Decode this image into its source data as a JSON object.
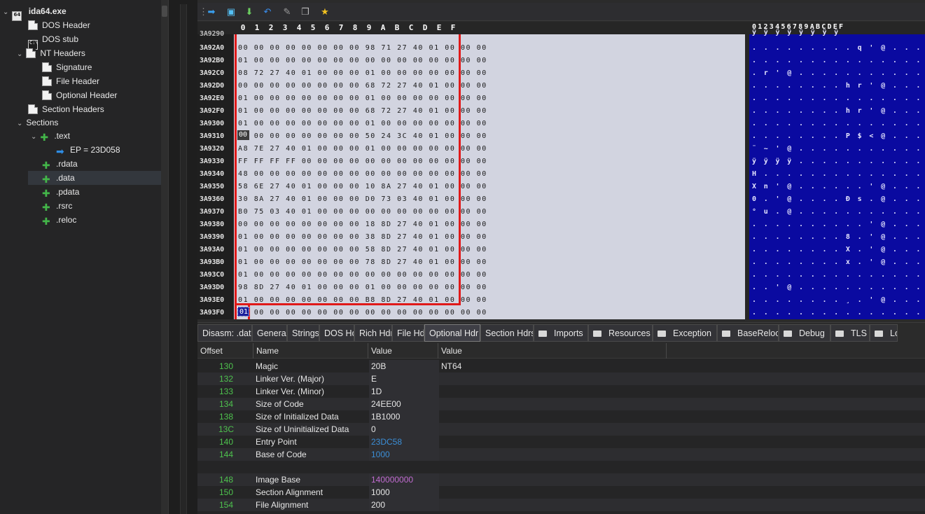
{
  "tree": {
    "root": "ida64.exe",
    "items": [
      {
        "label": "DOS Header",
        "icon": "document-icon"
      },
      {
        "label": "DOS stub",
        "icon": "console-icon"
      },
      {
        "label": "NT Headers",
        "icon": "document-icon"
      },
      {
        "label": "Signature",
        "icon": "document-icon"
      },
      {
        "label": "File Header",
        "icon": "document-icon"
      },
      {
        "label": "Optional Header",
        "icon": "document-icon"
      },
      {
        "label": "Section Headers",
        "icon": "document-icon"
      },
      {
        "label": "Sections",
        "icon": ""
      },
      {
        "label": ".text",
        "icon": "puzzle-icon"
      },
      {
        "label": "EP = 23D058",
        "icon": "arrow-right-icon"
      },
      {
        "label": ".rdata",
        "icon": "puzzle-icon"
      },
      {
        "label": ".data",
        "icon": "puzzle-icon"
      },
      {
        "label": ".pdata",
        "icon": "puzzle-icon"
      },
      {
        "label": ".rsrc",
        "icon": "puzzle-icon"
      },
      {
        "label": ".reloc",
        "icon": "puzzle-icon"
      }
    ]
  },
  "hex": {
    "columns": [
      "0",
      "1",
      "2",
      "3",
      "4",
      "5",
      "6",
      "7",
      "8",
      "9",
      "A",
      "B",
      "C",
      "D",
      "E",
      "F"
    ],
    "ascii_columns": "0123456789ABCDEF",
    "top_partial_addr": "3A9290",
    "rows": [
      {
        "addr": "3A92A0",
        "bytes": "00 00 00 00 00 00 00 00 98 71 27 40 01 00 00 00",
        "ascii": ". . . . . . . . . q ' @ . . . ."
      },
      {
        "addr": "3A92B0",
        "bytes": "01 00 00 00 00 00 00 00 00 00 00 00 00 00 00 00",
        "ascii": ". . . . . . . . . . . . . . . ."
      },
      {
        "addr": "3A92C0",
        "bytes": "08 72 27 40 01 00 00 00 01 00 00 00 00 00 00 00",
        "ascii": ". r ' @ . . . . . . . . . . . ."
      },
      {
        "addr": "3A92D0",
        "bytes": "00 00 00 00 00 00 00 00 68 72 27 40 01 00 00 00",
        "ascii": ". . . . . . . . h r ' @ . . . ."
      },
      {
        "addr": "3A92E0",
        "bytes": "01 00 00 00 00 00 00 00 01 00 00 00 00 00 00 00",
        "ascii": ". . . . . . . . . . . . . . . ."
      },
      {
        "addr": "3A92F0",
        "bytes": "01 00 00 00 00 00 00 00 68 72 27 40 01 00 00 00",
        "ascii": ". . . . . . . . h r ' @ . . . ."
      },
      {
        "addr": "3A9300",
        "bytes": "01 00 00 00 00 00 00 00 01 00 00 00 00 00 00 00",
        "ascii": ". . . . . . . . . . . . . . . ."
      },
      {
        "addr": "3A9310",
        "bytes": "00 00 00 00 00 00 00 00 50 24 3C 40 01 00 00 00",
        "ascii": ". . . . . . . . P $ < @ . . . ."
      },
      {
        "addr": "3A9320",
        "bytes": "A8 7E 27 40 01 00 00 00 01 00 00 00 00 00 00 00",
        "ascii": "¨ ~ ' @ . . . . . . . . . . . ."
      },
      {
        "addr": "3A9330",
        "bytes": "FF FF FF FF 00 00 00 00 00 00 00 00 00 00 00 00",
        "ascii": "ÿ ÿ ÿ ÿ . . . . . . . . . . . ."
      },
      {
        "addr": "3A9340",
        "bytes": "48 00 00 00 00 00 00 00 00 00 00 00 00 00 00 00",
        "ascii": "H . . . . . . . . . . . . . . ."
      },
      {
        "addr": "3A9350",
        "bytes": "58 6E 27 40 01 00 00 00 10 8A 27 40 01 00 00 00",
        "ascii": "X n ' @ . . . . . . ' @ . . . ."
      },
      {
        "addr": "3A9360",
        "bytes": "30 8A 27 40 01 00 00 00 D0 73 03 40 01 00 00 00",
        "ascii": "0 . ' @ . . . . Ð s . @ . . . ."
      },
      {
        "addr": "3A9370",
        "bytes": "B0 75 03 40 01 00 00 00 00 00 00 00 00 00 00 00",
        "ascii": "° u . @ . . . . . . . . . . . ."
      },
      {
        "addr": "3A9380",
        "bytes": "00 00 00 00 00 00 00 00 18 8D 27 40 01 00 00 00",
        "ascii": ". . . . . . . . . . ' @ . . . ."
      },
      {
        "addr": "3A9390",
        "bytes": "01 00 00 00 00 00 00 00 38 8D 27 40 01 00 00 00",
        "ascii": ". . . . . . . . 8 . ' @ . . . ."
      },
      {
        "addr": "3A93A0",
        "bytes": "01 00 00 00 00 00 00 00 58 8D 27 40 01 00 00 00",
        "ascii": ". . . . . . . . X . ' @ . . . ."
      },
      {
        "addr": "3A93B0",
        "bytes": "01 00 00 00 00 00 00 00 78 8D 27 40 01 00 00 00",
        "ascii": ". . . . . . . . x . ' @ . . . ."
      },
      {
        "addr": "3A93C0",
        "bytes": "01 00 00 00 00 00 00 00 00 00 00 00 00 00 00 00",
        "ascii": ". . . . . . . . . . . . . . . ."
      },
      {
        "addr": "3A93D0",
        "bytes": "98 8D 27 40 01 00 00 00 01 00 00 00 00 00 00 00",
        "ascii": ". . ' @ . . . . . . . . . . . ."
      },
      {
        "addr": "3A93E0",
        "bytes": "01 00 00 00 00 00 00 00 B8 8D 27 40 01 00 00 00",
        "ascii": ". . . . . . . . ¸ . ' @ . . . ."
      },
      {
        "addr": "3A93F0",
        "bytes": "01 00 00 00 00 00 00 00 00 00 00 00 00 00 00 00",
        "ascii": ". . . . . . . . . . . . . . . ."
      }
    ]
  },
  "tabs": [
    {
      "label": "Disasm: .data",
      "folder": false
    },
    {
      "label": "General",
      "folder": false
    },
    {
      "label": "Strings",
      "folder": false
    },
    {
      "label": "DOS Hdr",
      "folder": false
    },
    {
      "label": "Rich Hdr",
      "folder": false
    },
    {
      "label": "File Hdr",
      "folder": false
    },
    {
      "label": "Optional Hdr",
      "folder": false,
      "active": true
    },
    {
      "label": "Section Hdrs",
      "folder": false
    },
    {
      "label": "Imports",
      "folder": true
    },
    {
      "label": "Resources",
      "folder": true
    },
    {
      "label": "Exception",
      "folder": true
    },
    {
      "label": "BaseReloc",
      "folder": true
    },
    {
      "label": "Debug",
      "folder": true
    },
    {
      "label": "TLS",
      "folder": true
    },
    {
      "label": "Lo",
      "folder": true
    }
  ],
  "table": {
    "headers": [
      "Offset",
      "Name",
      "Value",
      "Value"
    ],
    "rows": [
      {
        "offset": "130",
        "name": "Magic",
        "value": "20B",
        "comment": "NT64",
        "style": ""
      },
      {
        "offset": "132",
        "name": "Linker Ver. (Major)",
        "value": "E",
        "comment": "",
        "style": ""
      },
      {
        "offset": "133",
        "name": "Linker Ver. (Minor)",
        "value": "1D",
        "comment": "",
        "style": ""
      },
      {
        "offset": "134",
        "name": "Size of Code",
        "value": "24EE00",
        "comment": "",
        "style": ""
      },
      {
        "offset": "138",
        "name": "Size of Initialized Data",
        "value": "1B1000",
        "comment": "",
        "style": ""
      },
      {
        "offset": "13C",
        "name": "Size of Uninitialized Data",
        "value": "0",
        "comment": "",
        "style": ""
      },
      {
        "offset": "140",
        "name": "Entry Point",
        "value": "23DC58",
        "comment": "",
        "style": "link"
      },
      {
        "offset": "144",
        "name": "Base of Code",
        "value": "1000",
        "comment": "",
        "style": "link"
      },
      {
        "offset": "",
        "name": "",
        "value": "",
        "comment": "",
        "style": ""
      },
      {
        "offset": "148",
        "name": "Image Base",
        "value": "140000000",
        "comment": "",
        "style": "purple"
      },
      {
        "offset": "150",
        "name": "Section Alignment",
        "value": "1000",
        "comment": "",
        "style": ""
      },
      {
        "offset": "154",
        "name": "File Alignment",
        "value": "200",
        "comment": "",
        "style": ""
      }
    ]
  },
  "colors": {
    "selection": "#e01919",
    "ascii_bg": "#0a0aa0",
    "hex_bg": "#d2d4e0",
    "offset_green": "#4ec24e",
    "link_blue": "#3b8ed6",
    "purple": "#c06bd0"
  }
}
